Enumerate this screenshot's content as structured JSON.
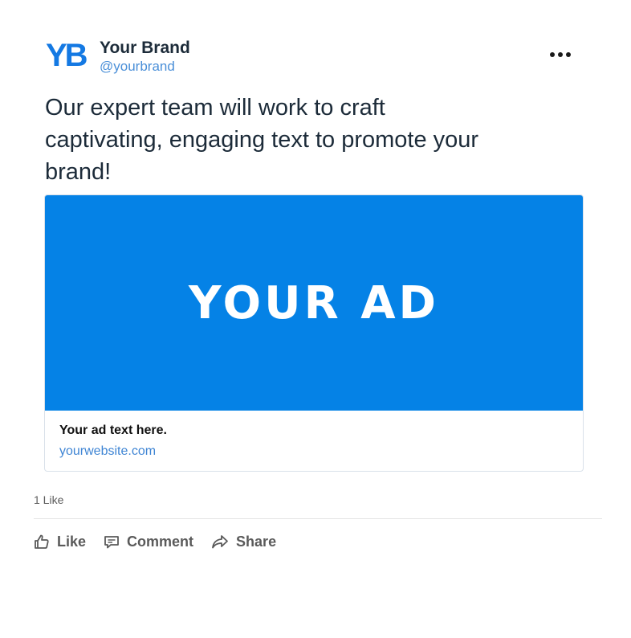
{
  "header": {
    "logo_text": "YB",
    "brand_name": "Your Brand",
    "handle": "@yourbrand"
  },
  "post": {
    "text": "Our expert team will work to craft captivating, engaging text to promote your brand!"
  },
  "ad": {
    "image_text": "YOUR AD",
    "headline": "Your ad text here.",
    "url": "yourwebsite.com"
  },
  "engagement": {
    "like_count": "1 Like"
  },
  "actions": {
    "like_label": "Like",
    "comment_label": "Comment",
    "share_label": "Share"
  },
  "colors": {
    "brand_blue": "#1479e3",
    "ad_background": "#0582e6",
    "link_blue": "#3f85d4",
    "text_dark": "#1c2b39",
    "action_gray": "#5a5a5a"
  }
}
